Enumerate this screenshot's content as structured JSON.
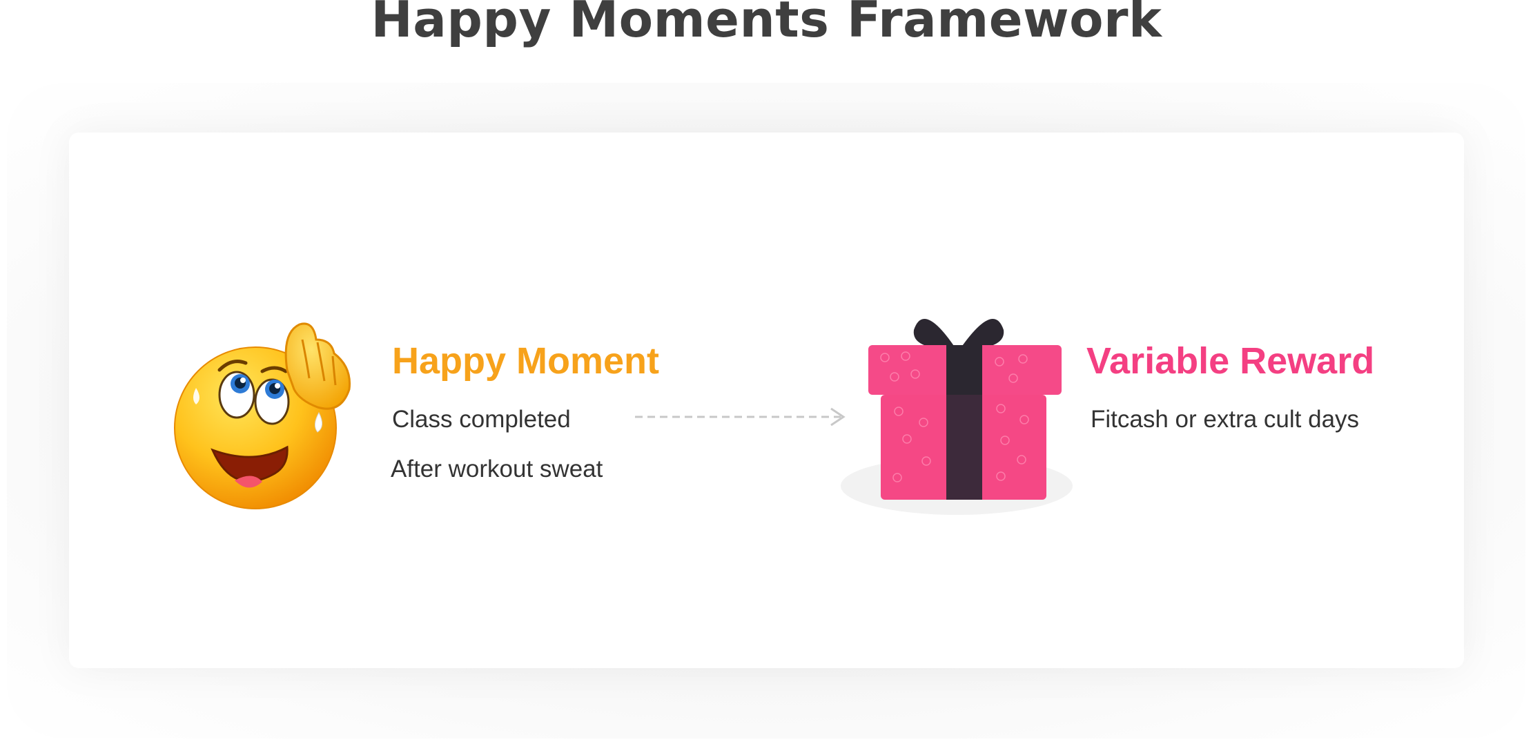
{
  "title": "Happy Moments Framework",
  "colors": {
    "happy_accent": "#F7A21B",
    "reward_accent": "#F43F82",
    "text": "#333333",
    "title": "#3f3f3f",
    "gift_box": "#F74A87",
    "gift_ribbon": "#2B2730"
  },
  "icons": {
    "left": "sweating-relieved-emoji-icon",
    "right": "gift-box-icon",
    "connector": "dashed-arrow-icon"
  },
  "happy_moment": {
    "heading": "Happy Moment",
    "items": [
      "Class completed",
      "After workout sweat"
    ]
  },
  "variable_reward": {
    "heading": "Variable Reward",
    "items": [
      "Fitcash or extra cult days"
    ]
  }
}
